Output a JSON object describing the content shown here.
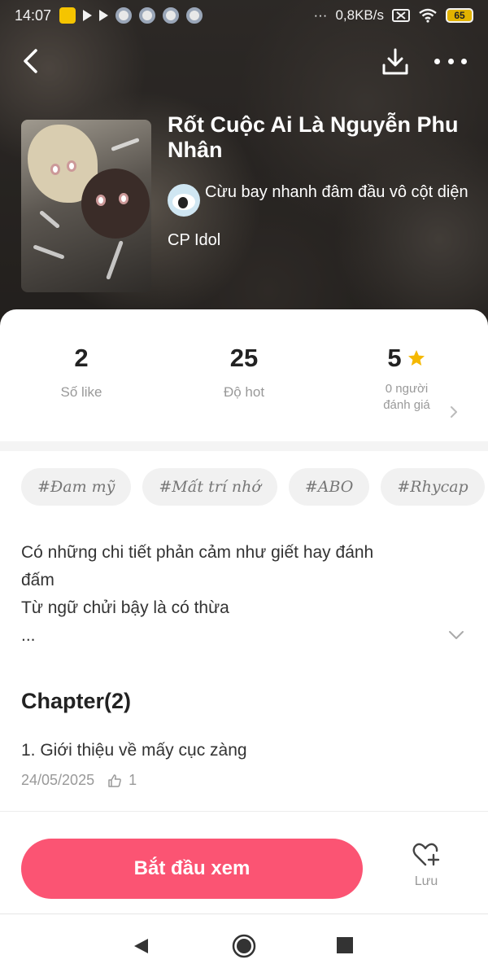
{
  "status_bar": {
    "time": "14:07",
    "net_speed": "0,8KB/s",
    "battery": "65"
  },
  "header": {
    "back_icon": "chevron-left-icon",
    "download_icon": "download-icon",
    "more_icon": "more-dots-icon"
  },
  "novel": {
    "title": "Rốt Cuộc Ai Là Nguyễn Phu Nhân",
    "author": "Cừu bay nhanh đâm đầu vô cột diện",
    "category": "CP Idol"
  },
  "stats": {
    "likes": {
      "value": "2",
      "label": "Số like"
    },
    "hot": {
      "value": "25",
      "label": "Độ hot"
    },
    "rating": {
      "value": "5",
      "label_line1": "0 người",
      "label_line2": "đánh giá"
    }
  },
  "tags": [
    "#Đam mỹ",
    "#Mất trí nhớ",
    "#ABO",
    "#Rhycap",
    "#"
  ],
  "description": {
    "line1": "Có những chi tiết phản cảm như giết hay đánh",
    "line2": "đấm",
    "line3": "Từ ngữ chửi bậy là có thừa",
    "line4": "..."
  },
  "chapters": {
    "heading": "Chapter(2)",
    "items": [
      {
        "title": "1. Giới thiệu về mấy cục zàng",
        "date": "24/05/2025",
        "likes": "1"
      }
    ]
  },
  "actions": {
    "start_label": "Bắt đầu xem",
    "save_label": "Lưu"
  },
  "colors": {
    "accent": "#fb5473",
    "star": "#f5b800"
  }
}
